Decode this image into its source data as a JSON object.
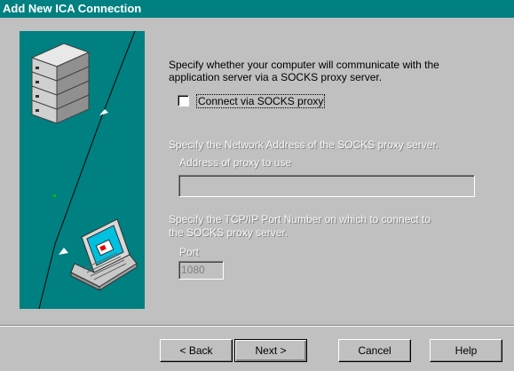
{
  "window": {
    "title": "Add New ICA Connection"
  },
  "intro": {
    "line1": "Specify whether your computer will communicate with the",
    "line2": "application server via a SOCKS proxy server."
  },
  "socks_checkbox": {
    "label": "Connect via SOCKS proxy",
    "checked": false
  },
  "proxy_address": {
    "description": "Specify the Network Address of the SOCKS proxy server.",
    "label": "Address of proxy to use",
    "value": ""
  },
  "proxy_port": {
    "description_line1": "Specify the TCP/IP Port Number on which to connect to",
    "description_line2": "the SOCKS proxy server.",
    "label": "Port",
    "value": "1080"
  },
  "buttons": {
    "back": "< Back",
    "next": "Next >",
    "cancel": "Cancel",
    "help": "Help"
  },
  "colors": {
    "titlebar": "#008080",
    "panel": "#008080",
    "face": "#c0c0c0"
  }
}
